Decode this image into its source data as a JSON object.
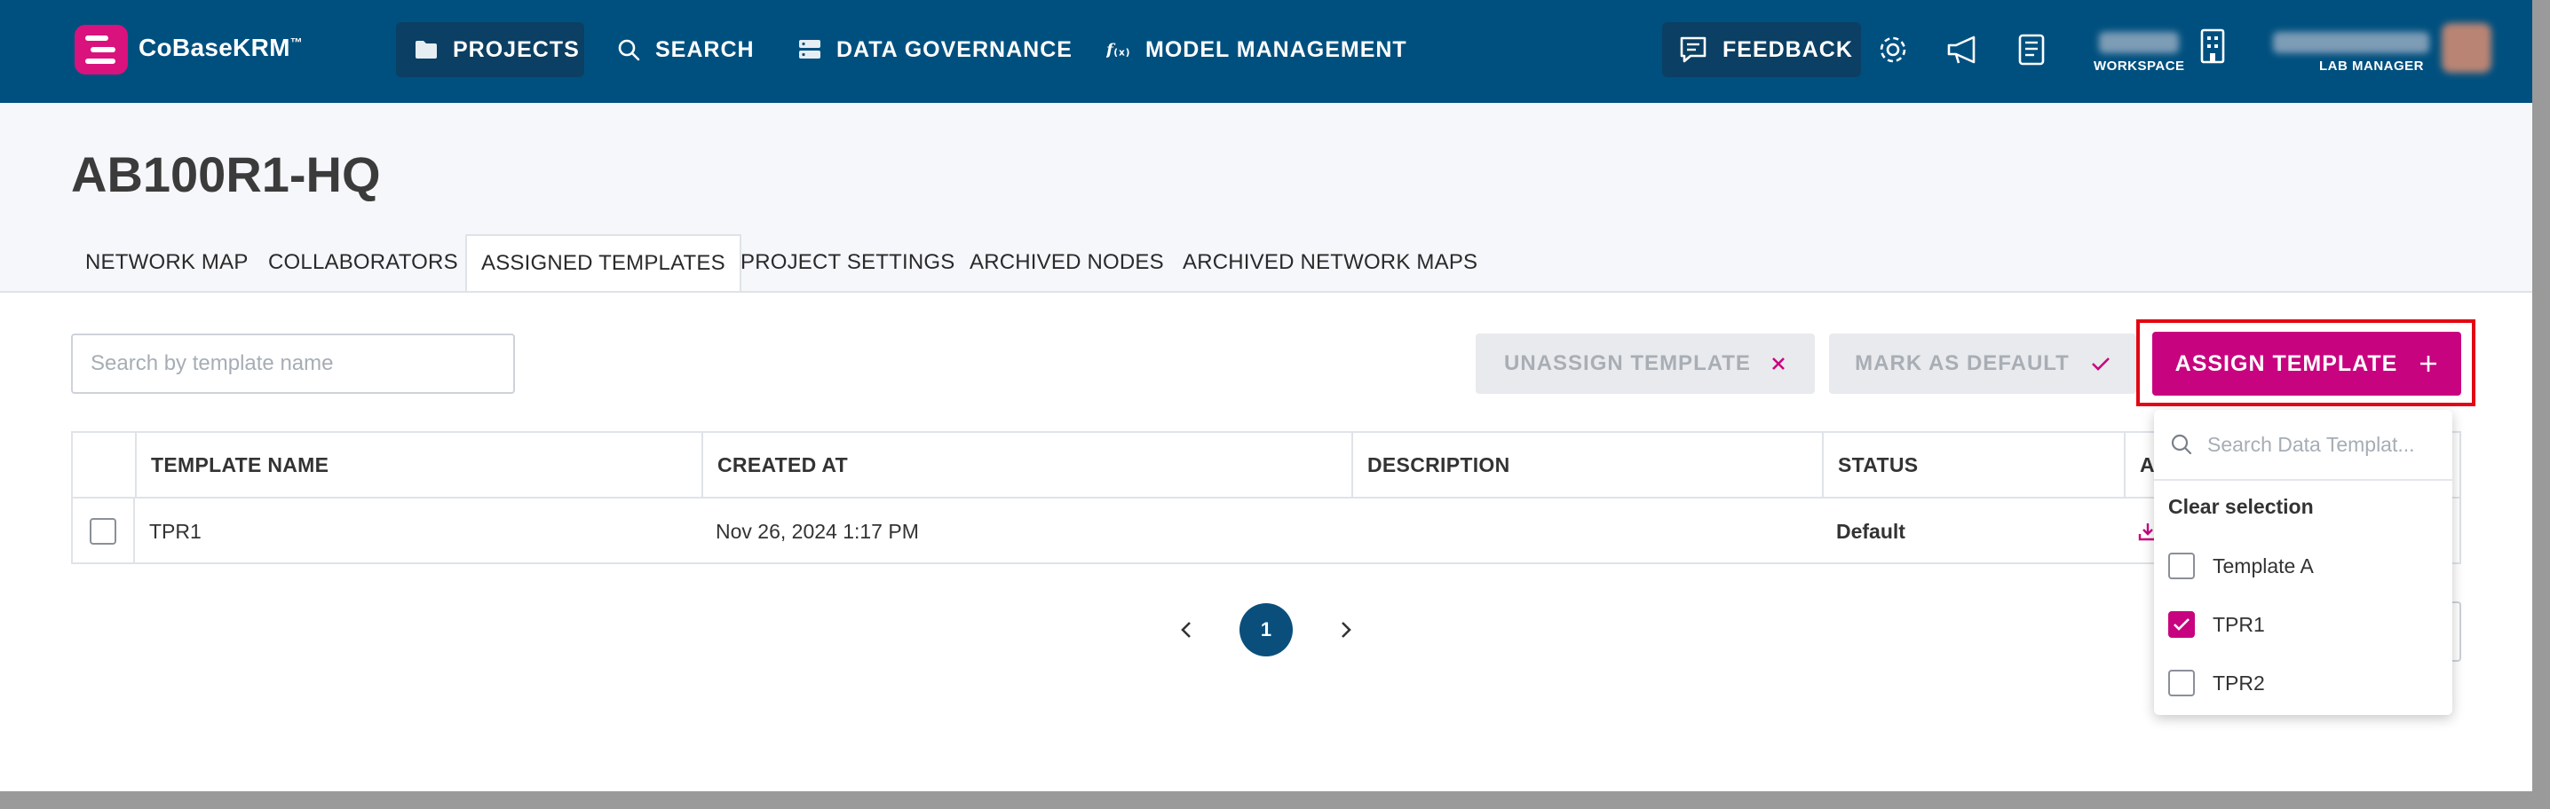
{
  "header": {
    "brand": "CoBaseKRM",
    "brand_tm": "™",
    "nav": [
      {
        "label": "PROJECTS",
        "icon": "folder-icon"
      },
      {
        "label": "SEARCH",
        "icon": "search-icon"
      },
      {
        "label": "DATA GOVERNANCE",
        "icon": "database-icon"
      },
      {
        "label": "MODEL MANAGEMENT",
        "icon": "function-icon"
      }
    ],
    "feedback_label": "FEEDBACK",
    "workspace_label": "WORKSPACE",
    "role_label": "LAB MANAGER"
  },
  "page": {
    "title": "AB100R1-HQ",
    "tabs": [
      {
        "label": "NETWORK MAP"
      },
      {
        "label": "COLLABORATORS"
      },
      {
        "label": "ASSIGNED TEMPLATES",
        "active": true
      },
      {
        "label": "PROJECT SETTINGS"
      },
      {
        "label": "ARCHIVED NODES"
      },
      {
        "label": "ARCHIVED NETWORK MAPS"
      }
    ]
  },
  "toolbar": {
    "search_placeholder": "Search by template name",
    "unassign_label": "UNASSIGN TEMPLATE",
    "mark_default_label": "MARK AS DEFAULT",
    "assign_label": "ASSIGN TEMPLATE"
  },
  "table": {
    "columns": [
      "TEMPLATE NAME",
      "CREATED AT",
      "DESCRIPTION",
      "STATUS",
      "A"
    ],
    "rows": [
      {
        "name": "TPR1",
        "created_at": "Nov 26, 2024 1:17 PM",
        "description": "",
        "status": "Default",
        "action_icon": "download-icon"
      }
    ]
  },
  "pagination": {
    "current": "1"
  },
  "dropdown": {
    "search_placeholder": "Search Data Templat...",
    "clear_label": "Clear selection",
    "options": [
      {
        "label": "Template A",
        "checked": false
      },
      {
        "label": "TPR1",
        "checked": true
      },
      {
        "label": "TPR2",
        "checked": false
      }
    ]
  },
  "colors": {
    "header_bg": "#00507f",
    "accent": "#c8037f",
    "highlight_border": "#e30613"
  }
}
